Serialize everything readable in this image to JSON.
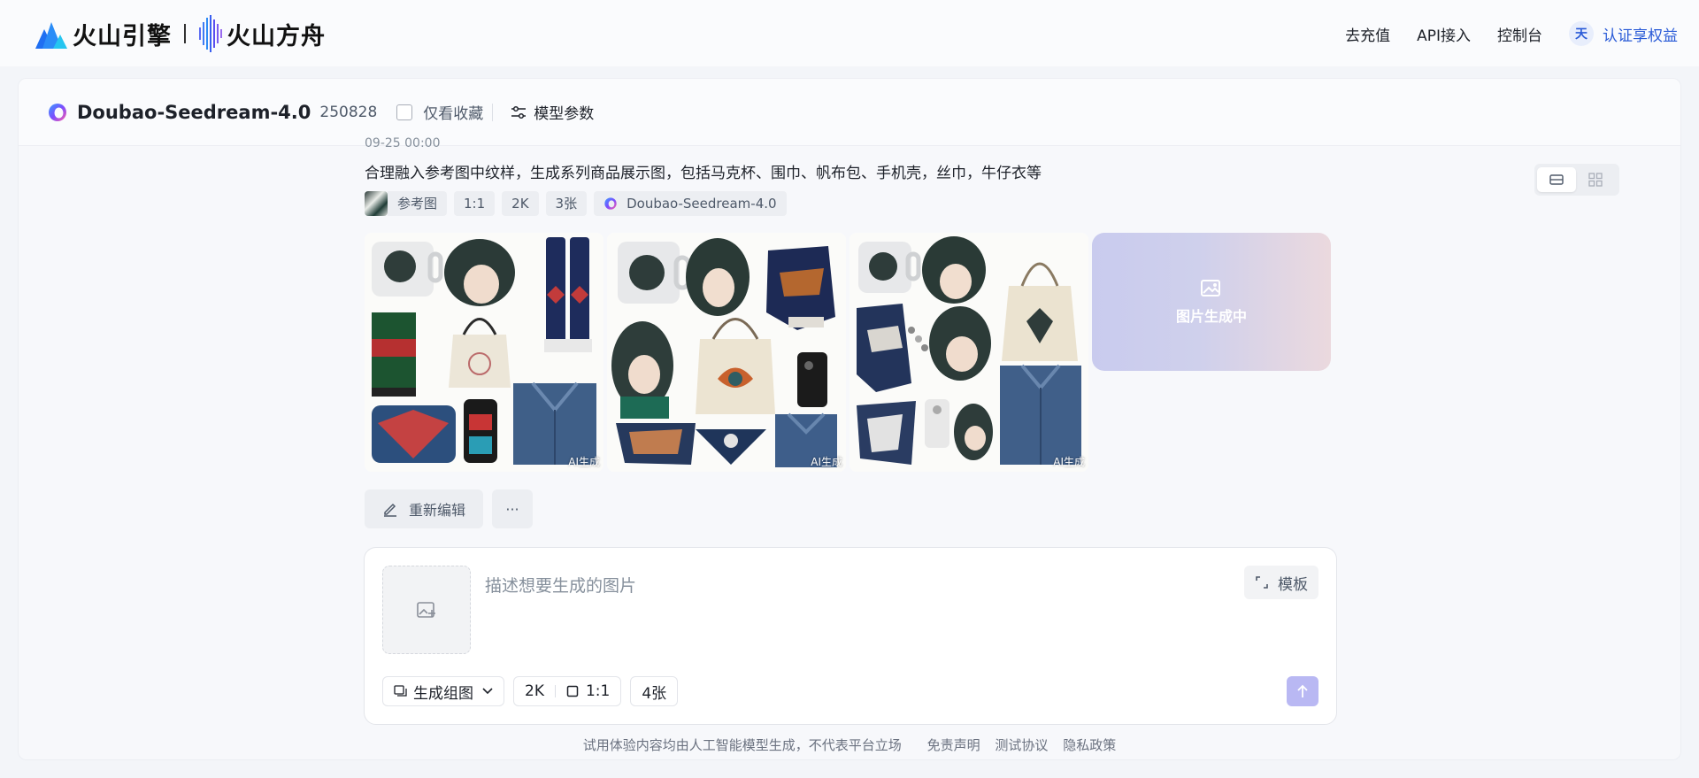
{
  "nav": {
    "brand1": "火山引擎",
    "brand2": "火山方舟",
    "links": [
      "去充值",
      "API接入",
      "控制台"
    ],
    "avatar": "天",
    "cert": "认证享权益"
  },
  "header": {
    "model_name": "Doubao-Seedream-4.0",
    "model_version": "250828",
    "fav_label": "仅看收藏",
    "params_label": "模型参数"
  },
  "record": {
    "time_partial": "09-25 00:00",
    "prompt": "合理融入参考图中纹样，生成系列商品展示图，包括马克杯、围巾、帆布包、手机壳，丝巾，牛仔衣等",
    "tags": {
      "ref": "参考图",
      "ratio": "1:1",
      "res": "2K",
      "count": "3张",
      "model": "Doubao-Seedream-4.0"
    },
    "images": [
      {
        "label": "AI生成"
      },
      {
        "label": "AI生成"
      },
      {
        "label": "AI生成"
      }
    ],
    "generating_label": "图片生成中",
    "actions": {
      "edit": "重新编辑",
      "more": "···"
    }
  },
  "composer": {
    "placeholder": "描述想要生成的图片",
    "template": "模板",
    "mode": "生成组图",
    "resolution": "2K",
    "ratio": "1:1",
    "count": "4张"
  },
  "footer": {
    "disclaimer": "试用体验内容均由人工智能模型生成，不代表平台立场",
    "links": [
      "免责声明",
      "测试协议",
      "隐私政策"
    ]
  },
  "colors": {
    "accent": "#2a5bd7",
    "send_button": "#b9b8f3",
    "generating_gradient": [
      "#c9cbee",
      "#ebd9de"
    ]
  }
}
